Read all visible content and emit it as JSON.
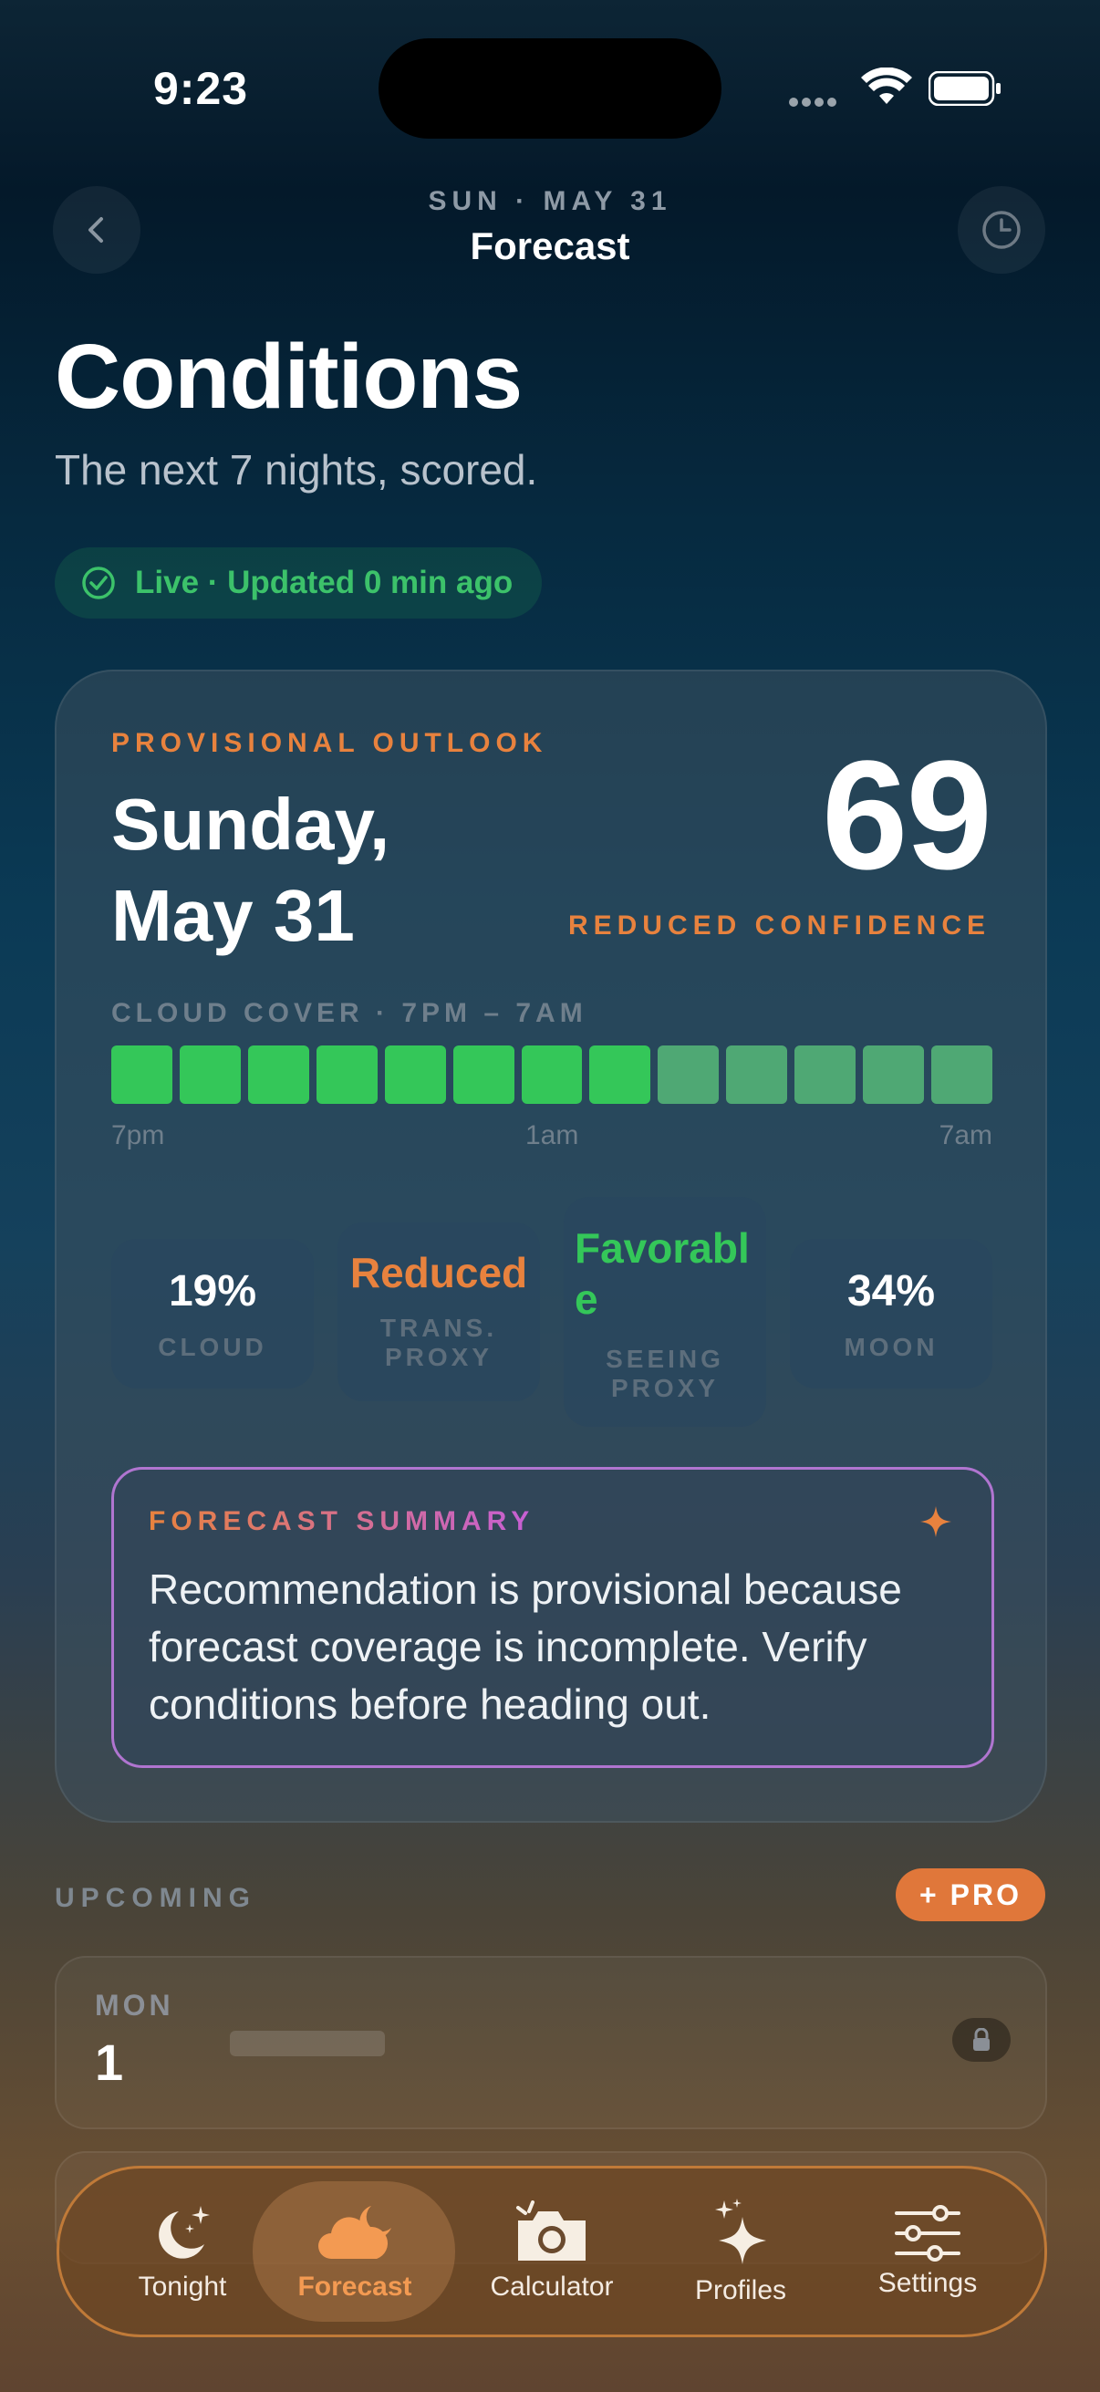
{
  "status_bar": {
    "time": "9:23"
  },
  "nav": {
    "subtitle": "SUN · MAY 31",
    "title": "Forecast"
  },
  "header": {
    "title": "Conditions",
    "subtitle": "The next 7 nights, scored.",
    "live_status": "Live · Updated 0 min ago"
  },
  "card": {
    "eyebrow": "PROVISIONAL OUTLOOK",
    "date_line1": "Sunday,",
    "date_line2": "May 31",
    "score": "69",
    "confidence": "REDUCED CONFIDENCE",
    "cloud_label": "CLOUD COVER · 7PM – 7AM",
    "cloud_segments": [
      "clear",
      "clear",
      "clear",
      "clear",
      "clear",
      "clear",
      "clear",
      "clear",
      "partial",
      "partial",
      "partial",
      "partial",
      "partial"
    ],
    "ticks": {
      "start": "7pm",
      "mid": "1am",
      "end": "7am"
    },
    "metrics": [
      {
        "value": "19%",
        "label": "CLOUD",
        "value_color": "#ffffff"
      },
      {
        "value": "Reduced",
        "label": "TRANS. PROXY",
        "value_color": "#e8823e"
      },
      {
        "value": "Favorable",
        "label": "SEEING PROXY",
        "value_color": "#34c759"
      },
      {
        "value": "34%",
        "label": "MOON",
        "value_color": "#ffffff"
      }
    ],
    "summary": {
      "eyebrow": "FORECAST SUMMARY",
      "text": "Recommendation is provisional because forecast coverage is incomplete. Verify conditions before heading out.",
      "icon": "sparkle-icon"
    }
  },
  "upcoming": {
    "label": "UPCOMING",
    "pro_badge": "+ PRO",
    "rows": [
      {
        "day": "MON",
        "date": "1",
        "locked": true
      }
    ]
  },
  "tabs": [
    {
      "label": "Tonight",
      "icon": "moon-stars-icon",
      "active": false
    },
    {
      "label": "Forecast",
      "icon": "cloud-moon-icon",
      "active": true
    },
    {
      "label": "Calculator",
      "icon": "camera-icon",
      "active": false
    },
    {
      "label": "Profiles",
      "icon": "sparkles-icon",
      "active": false
    },
    {
      "label": "Settings",
      "icon": "sliders-icon",
      "active": false
    }
  ],
  "colors": {
    "accent_orange": "#e8823e",
    "live_green": "#3cc26a",
    "cloud_clear": "#34c759",
    "cloud_partial": "#4fa874",
    "summary_border": "#b075d0"
  }
}
